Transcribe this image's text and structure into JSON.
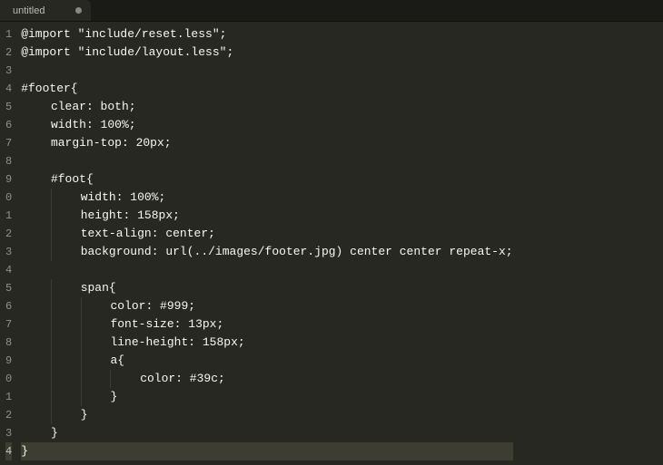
{
  "tab": {
    "title": "untitled",
    "dirty": true
  },
  "gutter": {
    "start": 1,
    "count": 24,
    "wrapAt": 10,
    "currentLine": 24
  },
  "code": {
    "lines": [
      "@import \"include/reset.less\";",
      "@import \"include/layout.less\";",
      "",
      "#footer{",
      "    clear: both;",
      "    width: 100%;",
      "    margin-top: 20px;",
      "",
      "    #foot{",
      "        width: 100%;",
      "        height: 158px;",
      "        text-align: center;",
      "        background: url(../images/footer.jpg) center center repeat-x;",
      "",
      "        span{",
      "            color: #999;",
      "            font-size: 13px;",
      "            line-height: 158px;",
      "            a{",
      "                color: #39c;",
      "            }",
      "        }",
      "    }",
      "}"
    ]
  }
}
